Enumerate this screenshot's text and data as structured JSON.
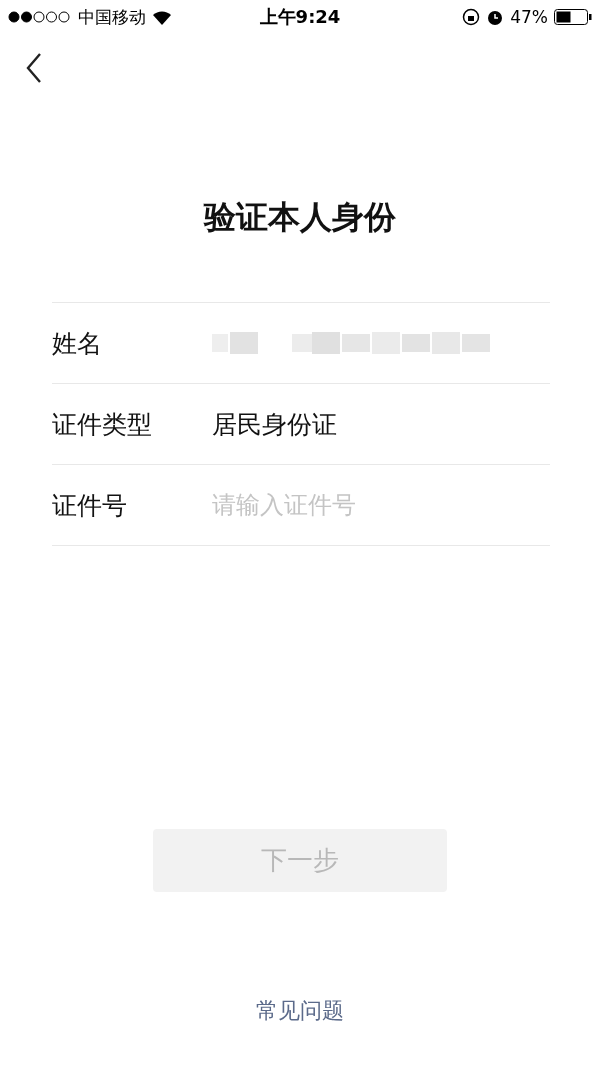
{
  "status_bar": {
    "carrier": "中国移动",
    "time": "上午9:24",
    "battery": "47%"
  },
  "title": "验证本人身份",
  "form_rows": [
    {
      "label": "姓名",
      "kind": "masked"
    },
    {
      "label": "证件类型",
      "kind": "value",
      "value": "居民身份证"
    },
    {
      "label": "证件号",
      "kind": "input",
      "placeholder": "请输入证件号"
    }
  ],
  "next_button": {
    "label": "下一步",
    "disabled": true
  },
  "faq_link": "常见问题"
}
